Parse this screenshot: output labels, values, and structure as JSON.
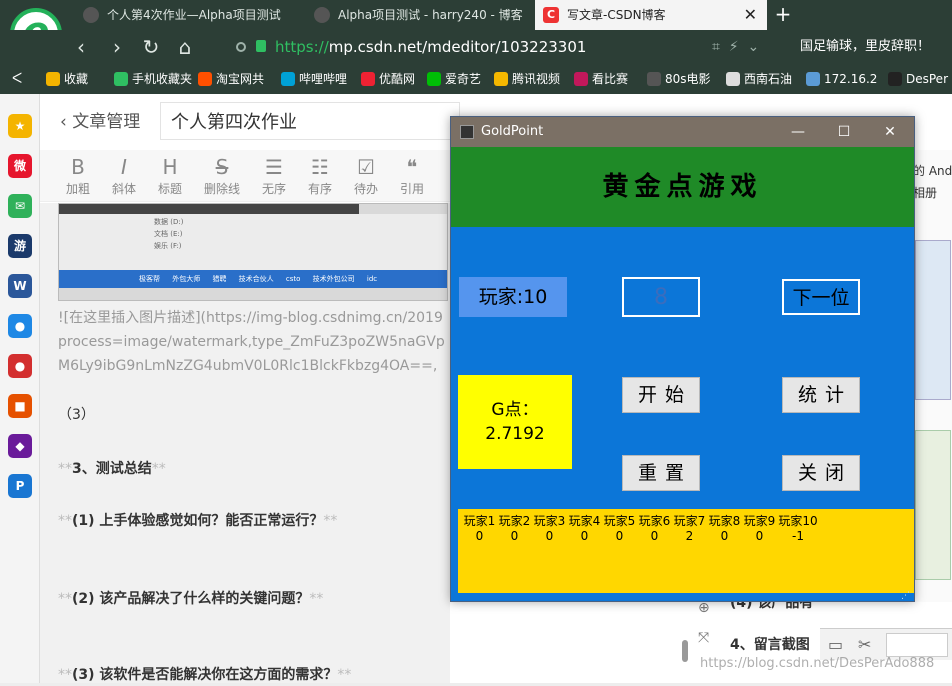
{
  "browser": {
    "tabs": [
      {
        "title": "个人第4次作业—Alpha项目测试",
        "active": false
      },
      {
        "title": "Alpha项目测试 - harry240 - 博客",
        "active": false
      },
      {
        "title": "写文章-CSDN博客",
        "active": true
      }
    ],
    "new_tab": "+",
    "url": {
      "scheme": "https://",
      "host": "mp.csdn.net/mdeditor/103223301"
    },
    "news": "国足输球，里皮辞职！",
    "bookmarks": [
      "收藏",
      "手机收藏夹",
      "淘宝网共",
      "哔哩哔哩",
      "优酷网",
      "爱奇艺",
      "腾讯视频",
      "看比赛",
      "80s电影",
      "西南石油",
      "172.16.2",
      "DesPer"
    ],
    "colors": {
      "chrome": "#2c3e36",
      "secure": "#2fbf62"
    }
  },
  "sidebar": {
    "icons": [
      {
        "name": "favorites-icon",
        "glyph": "★",
        "color": "#f4b400"
      },
      {
        "name": "weibo-icon",
        "glyph": "微",
        "color": "#e6162d"
      },
      {
        "name": "mail-icon",
        "glyph": "✉",
        "color": "#2fb15a"
      },
      {
        "name": "game-icon",
        "glyph": "游",
        "color": "#1b3a6b"
      },
      {
        "name": "word-icon",
        "glyph": "W",
        "color": "#2b579a"
      },
      {
        "name": "chat-icon",
        "glyph": "●",
        "color": "#1e88e5"
      },
      {
        "name": "angry-birds-icon",
        "glyph": "●",
        "color": "#d32f2f"
      },
      {
        "name": "app-icon",
        "glyph": "■",
        "color": "#e65100"
      },
      {
        "name": "puzzle-icon",
        "glyph": "◆",
        "color": "#6a1b9a"
      },
      {
        "name": "p-app-icon",
        "glyph": "P",
        "color": "#1976d2"
      }
    ]
  },
  "editor": {
    "back_label": "文章管理",
    "title_value": "个人第四次作业",
    "toolbar": [
      {
        "glyph": "B",
        "label": "加粗"
      },
      {
        "glyph": "I",
        "label": "斜体"
      },
      {
        "glyph": "H",
        "label": "标题"
      },
      {
        "glyph": "S",
        "label": "删除线"
      },
      {
        "glyph": "☰",
        "label": "无序"
      },
      {
        "glyph": "☷",
        "label": "有序"
      },
      {
        "glyph": "☑",
        "label": "待办"
      },
      {
        "glyph": "❝",
        "label": "引用"
      }
    ],
    "image_markdown": "![在这里插入图片描述](https://img-blog.csdnimg.cn/2019process=image/watermark,type_ZmFuZ3poZW5naGVpM6Ly9ibG9nLmNzZG4ubmV0L0Rlc1BlckFkbzg4OA==,",
    "thumb_text": "数据 (D:)\n文档 (E:)\n娱乐 (F:)",
    "thumb_tabs": "极客帮 外包大师 猎聘 技术合伙人 csto 技术外包公司 idc",
    "para_3": "（3）",
    "section_title": "3、测试总结",
    "q1": "(1)  上手体验感觉如何？能否正常运行？",
    "q2": "(2)  该产品解决了什么样的关键问题？",
    "q3": "(3)  该软件是否能解决你在这方面的需求？",
    "md_marker": "**",
    "right_item1": "(4) 该产品有",
    "right_item2": "4、留言截图",
    "watermark": "https://blog.csdn.net/DesPerAdo888"
  },
  "goldpoint": {
    "window_title": "GoldPoint",
    "heading": "黄金点游戏",
    "player_label": "玩家:10",
    "input_value": "8",
    "next_button": "下一位",
    "start_button": "开始",
    "stats_button": "统计",
    "reset_button": "重置",
    "close_button": "关闭",
    "gpoint_label": "G点：",
    "gpoint_value": "2.7192",
    "players": [
      "玩家1",
      "玩家2",
      "玩家3",
      "玩家4",
      "玩家5",
      "玩家6",
      "玩家7",
      "玩家8",
      "玩家9",
      "玩家10"
    ],
    "scores": [
      "0",
      "0",
      "0",
      "0",
      "0",
      "0",
      "2",
      "0",
      "0",
      "-1"
    ],
    "colors": {
      "header": "#1f8a27",
      "body": "#0c76d8",
      "gpoint": "#ffff00",
      "scores": "#ffd700",
      "player_label": "#5595ee"
    }
  }
}
